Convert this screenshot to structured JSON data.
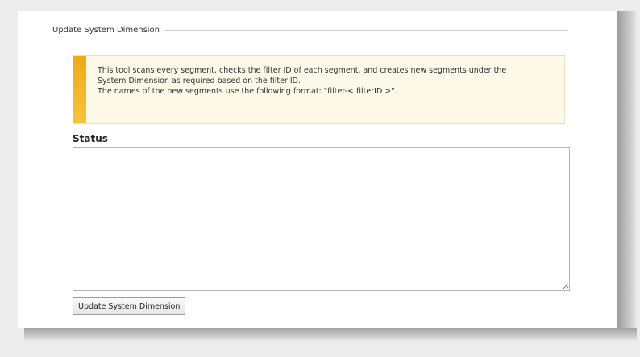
{
  "section": {
    "title": "Update System Dimension"
  },
  "notice": {
    "lines": [
      "This tool scans every segment, checks the filter ID of each segment, and creates new segments under the",
      "System Dimension as required based on the filter ID.",
      "The names of the new segments use the following format: \"filter-< filterID >\"."
    ],
    "accent_color": "#f2b21f"
  },
  "status": {
    "label": "Status",
    "value": ""
  },
  "actions": {
    "update_label": "Update System Dimension"
  }
}
